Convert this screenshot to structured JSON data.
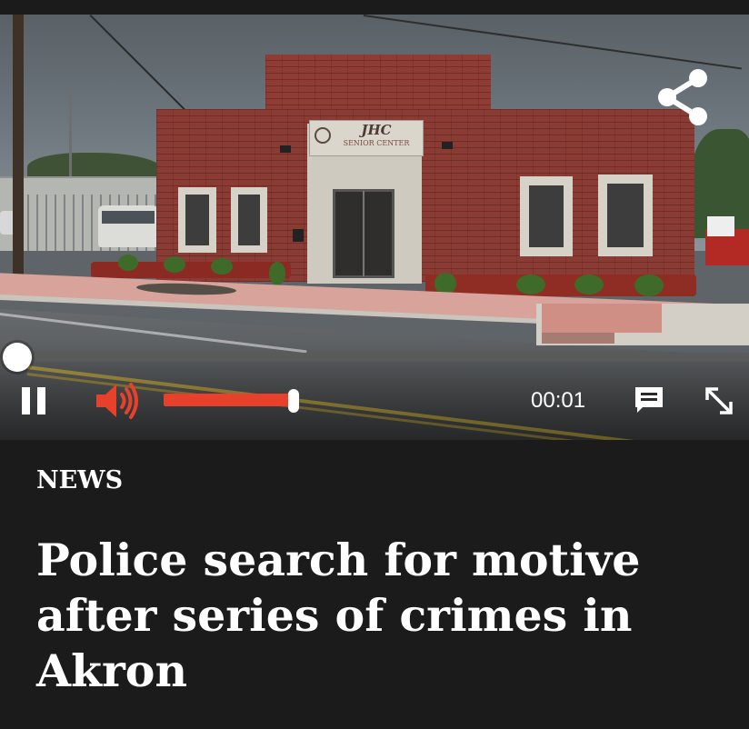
{
  "video": {
    "sign_main": "JHC",
    "sign_sub": "SENIOR CENTER",
    "share_icon": "share-icon",
    "progress": 0.0,
    "volume": 0.95,
    "time": "00:01",
    "icons": {
      "pause": "pause-icon",
      "volume": "volume-icon",
      "captions": "captions-icon",
      "fullscreen": "fullscreen-icon"
    },
    "accent_color": "#e8412b"
  },
  "article": {
    "section": "NEWS",
    "headline": "Police search for motive after series of crimes in Akron"
  }
}
